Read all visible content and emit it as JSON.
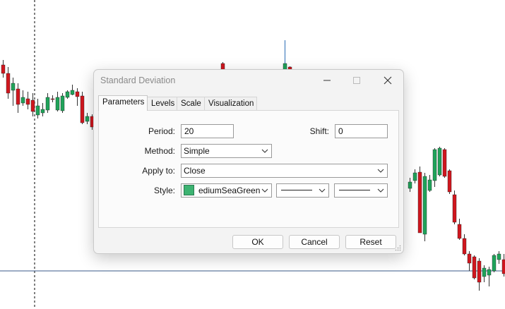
{
  "dialog": {
    "title": "Standard Deviation",
    "tabs": [
      {
        "label": "Parameters",
        "active": true
      },
      {
        "label": "Levels"
      },
      {
        "label": "Scale"
      },
      {
        "label": "Visualization"
      }
    ],
    "fields": {
      "period_label": "Period:",
      "period_value": "20",
      "shift_label": "Shift:",
      "shift_value": "0",
      "method_label": "Method:",
      "method_value": "Simple",
      "apply_label": "Apply to:",
      "apply_value": "Close",
      "style_label": "Style:",
      "color_value": "ediumSeaGreen",
      "color_hex": "#3cb371"
    },
    "buttons": {
      "ok": "OK",
      "cancel": "Cancel",
      "reset": "Reset"
    }
  },
  "chart": {
    "bull_color": "#1fa35a",
    "bear_color": "#d0161e",
    "wick_color": "#2a6db5"
  }
}
